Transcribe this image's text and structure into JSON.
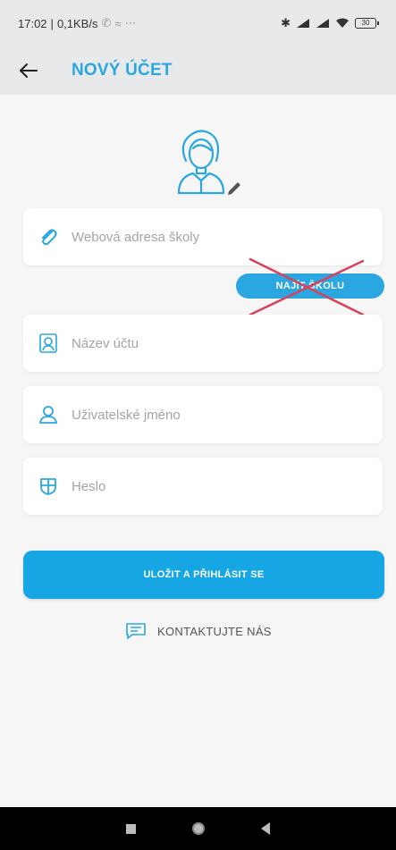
{
  "status_bar": {
    "time": "17:02",
    "speed": "0,1KB/s",
    "extra": "⋯",
    "battery": "30"
  },
  "app_bar": {
    "back_icon": "arrow-left-icon",
    "title": "NOVÝ ÚČET"
  },
  "form": {
    "avatar_icon": "user-avatar-edit-icon",
    "school_url": {
      "icon": "paperclip-icon",
      "placeholder": "Webová adresa školy",
      "value": ""
    },
    "find_school_button": "NAJÍT ŠKOLU",
    "account_name": {
      "icon": "account-card-icon",
      "placeholder": "Název účtu",
      "value": ""
    },
    "username": {
      "icon": "user-icon",
      "placeholder": "Uživatelské jméno",
      "value": ""
    },
    "password": {
      "icon": "shield-icon",
      "placeholder": "Heslo",
      "value": ""
    },
    "save_button": "ULOŽIT A PŘIHLÁSIT SE",
    "contact_link": "KONTAKTUJTE NÁS"
  },
  "colors": {
    "accent": "#2aa7e0",
    "button": "#16a6e4",
    "cross": "#d9425a",
    "app_bar_bg": "#e8e9ea"
  }
}
